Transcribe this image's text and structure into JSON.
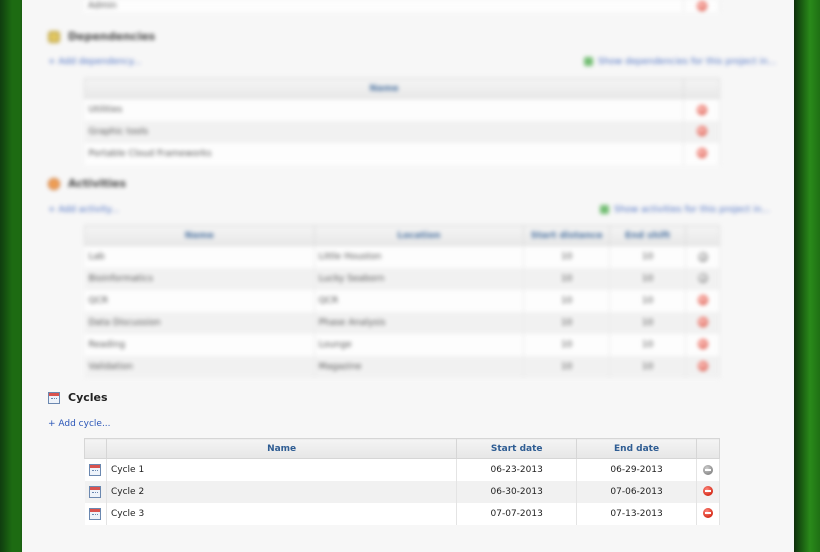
{
  "prev_section": {
    "row_label": "Admin"
  },
  "dependencies": {
    "title": "Dependencies",
    "add_label": "+ Add dependency...",
    "export_label": "Show dependencies for this project in...",
    "header": {
      "name": "Name"
    },
    "rows": [
      {
        "name": "Utilities"
      },
      {
        "name": "Graphic tools"
      },
      {
        "name": "Portable Cloud Frameworks"
      }
    ]
  },
  "activities": {
    "title": "Activities",
    "add_label": "+ Add activity...",
    "export_label": "Show activities for this project in...",
    "header": {
      "name": "Name",
      "location": "Location",
      "start_date": "Start distance",
      "end_date": "End shift"
    },
    "rows": [
      {
        "name": "Lab",
        "location": "Little Houston",
        "start": "10",
        "end": "10"
      },
      {
        "name": "Bioinformatics",
        "location": "Lucky Seaborn",
        "start": "10",
        "end": "10"
      },
      {
        "name": "QCR",
        "location": "QCR",
        "start": "10",
        "end": "10"
      },
      {
        "name": "Data Discussion",
        "location": "Phase Analysis",
        "start": "10",
        "end": "10"
      },
      {
        "name": "Reading",
        "location": "Lounge",
        "start": "10",
        "end": "10"
      },
      {
        "name": "Validation",
        "location": "Magazine",
        "start": "10",
        "end": "10"
      }
    ]
  },
  "cycles": {
    "title": "Cycles",
    "add_label": "+ Add cycle...",
    "header": {
      "name": "Name",
      "start_date": "Start date",
      "end_date": "End date"
    },
    "rows": [
      {
        "name": "Cycle 1",
        "start": "06-23-2013",
        "end": "06-29-2013",
        "removable": false
      },
      {
        "name": "Cycle 2",
        "start": "06-30-2013",
        "end": "07-06-2013",
        "removable": true
      },
      {
        "name": "Cycle 3",
        "start": "07-07-2013",
        "end": "07-13-2013",
        "removable": true
      }
    ]
  },
  "colors": {
    "link": "#2a56b8",
    "header_text": "#2f5d93",
    "remove": "#d62c1a"
  },
  "icons": {
    "cycles": "calendar-icon",
    "row": "calendar-icon",
    "remove": "remove-icon"
  }
}
